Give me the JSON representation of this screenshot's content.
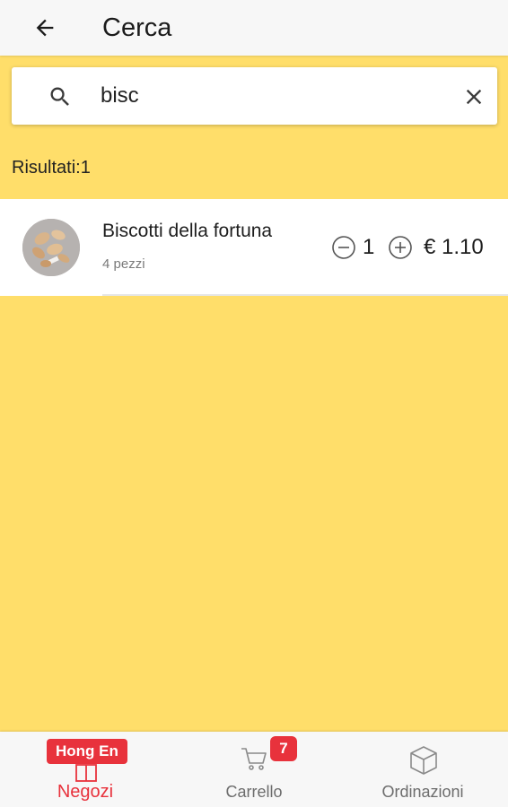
{
  "header": {
    "title": "Cerca",
    "back_icon": "arrow-left-icon"
  },
  "search": {
    "value": "bisc",
    "search_icon": "search-icon",
    "clear_icon": "close-icon"
  },
  "results": {
    "label": "Risultati:1",
    "items": [
      {
        "name": "Biscotti della fortuna",
        "subtitle": "4 pezzi",
        "quantity": "1",
        "price": "€ 1.10"
      }
    ]
  },
  "bottom_nav": {
    "shops": {
      "label": "Negozi",
      "badge": "Hong En",
      "icon": "store-icon"
    },
    "cart": {
      "label": "Carrello",
      "badge": "7",
      "icon": "cart-icon"
    },
    "orders": {
      "label": "Ordinazioni",
      "icon": "box-icon"
    }
  },
  "colors": {
    "background": "#FFDE6A",
    "accent": "#E8323C",
    "bar": "#F7F7F7"
  }
}
